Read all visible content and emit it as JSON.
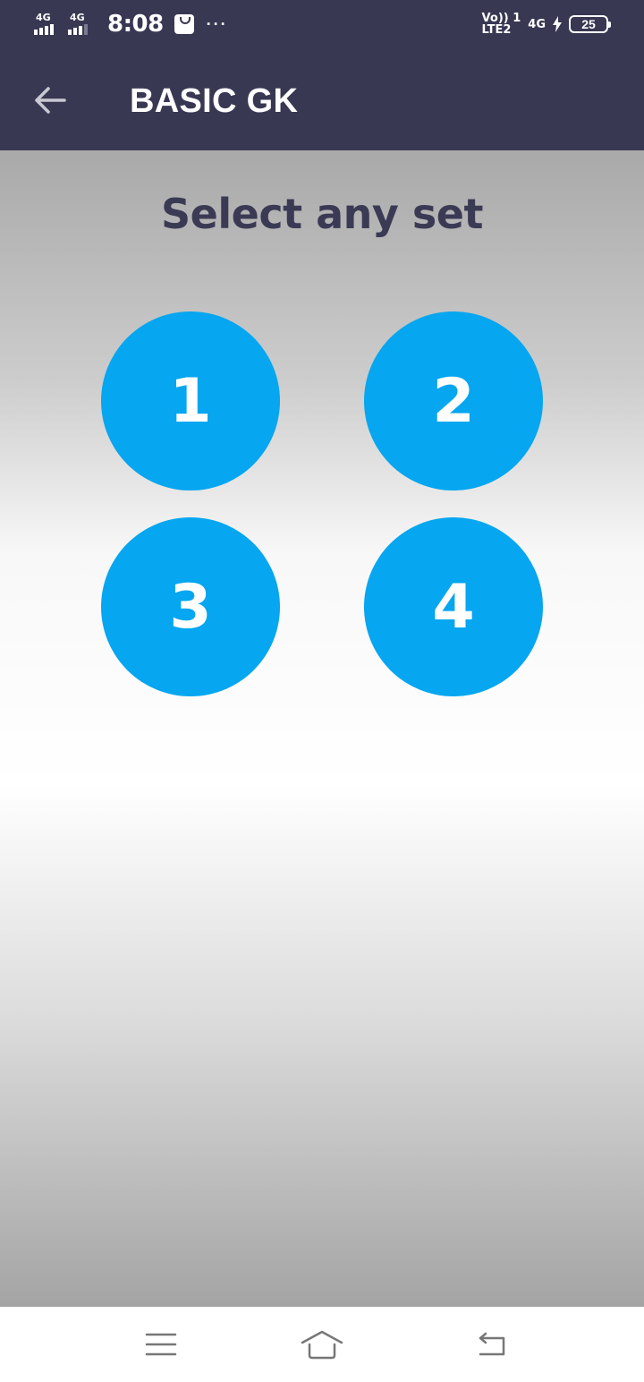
{
  "status_bar": {
    "sim1_network": "4G",
    "sim2_network": "4G",
    "time": "8:08",
    "overflow": "···",
    "volte_line1": "Vo)) 1",
    "volte_line2": "LTE2",
    "data_network": "4G",
    "battery_level": "25"
  },
  "app_bar": {
    "title": "BASIC GK",
    "back_icon": "arrow-left-icon"
  },
  "main": {
    "heading": "Select any set",
    "sets": [
      {
        "label": "1"
      },
      {
        "label": "2"
      },
      {
        "label": "3"
      },
      {
        "label": "4"
      }
    ],
    "button_color": "#06a6f0"
  },
  "nav_bar": {
    "menu_icon": "menu-icon",
    "home_icon": "home-icon",
    "back_icon": "back-icon"
  },
  "colors": {
    "header_bg": "#383853",
    "heading_text": "#3b3a55",
    "accent": "#06a6f0"
  }
}
